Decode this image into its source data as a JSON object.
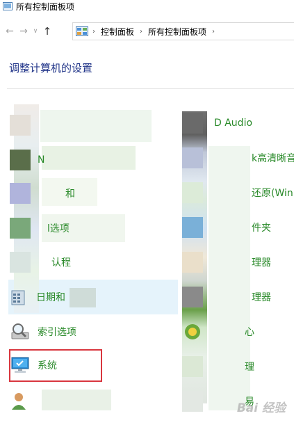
{
  "window": {
    "title": "所有控制面板项"
  },
  "nav": {
    "back_glyph": "←",
    "forward_glyph": "→",
    "recent_glyph": "∨",
    "up_glyph": "↑"
  },
  "address": {
    "sep": "›",
    "crumbs": [
      "控制面板",
      "所有控制面板项"
    ]
  },
  "page": {
    "title": "调整计算机的设置"
  },
  "left_items": [
    {
      "label": "",
      "icon": "blurred-icon"
    },
    {
      "label": "N",
      "icon": "blurred-icon"
    },
    {
      "label": "和",
      "icon": "blurred-icon"
    },
    {
      "label": "l选项",
      "icon": "blurred-icon"
    },
    {
      "label": "认程",
      "icon": "blurred-icon"
    },
    {
      "label": "日期和",
      "icon": "calendar-icon"
    },
    {
      "label": "索引选项",
      "icon": "indexing-options-icon"
    },
    {
      "label": "系统",
      "icon": "system-icon"
    },
    {
      "label": "",
      "icon": "user-accounts-icon"
    }
  ],
  "right_items": [
    {
      "label": "D     Audio"
    },
    {
      "label": "k高清晰音"
    },
    {
      "label": "还原(Win"
    },
    {
      "label": "件夹"
    },
    {
      "label": "理器"
    },
    {
      "label": "理器"
    },
    {
      "label": "心"
    },
    {
      "label": "理"
    },
    {
      "label": "易"
    }
  ],
  "watermark": "Bai    经验",
  "colors": {
    "link": "#1a6fb5",
    "title": "#1e3287",
    "highlight": "#d9363e"
  }
}
